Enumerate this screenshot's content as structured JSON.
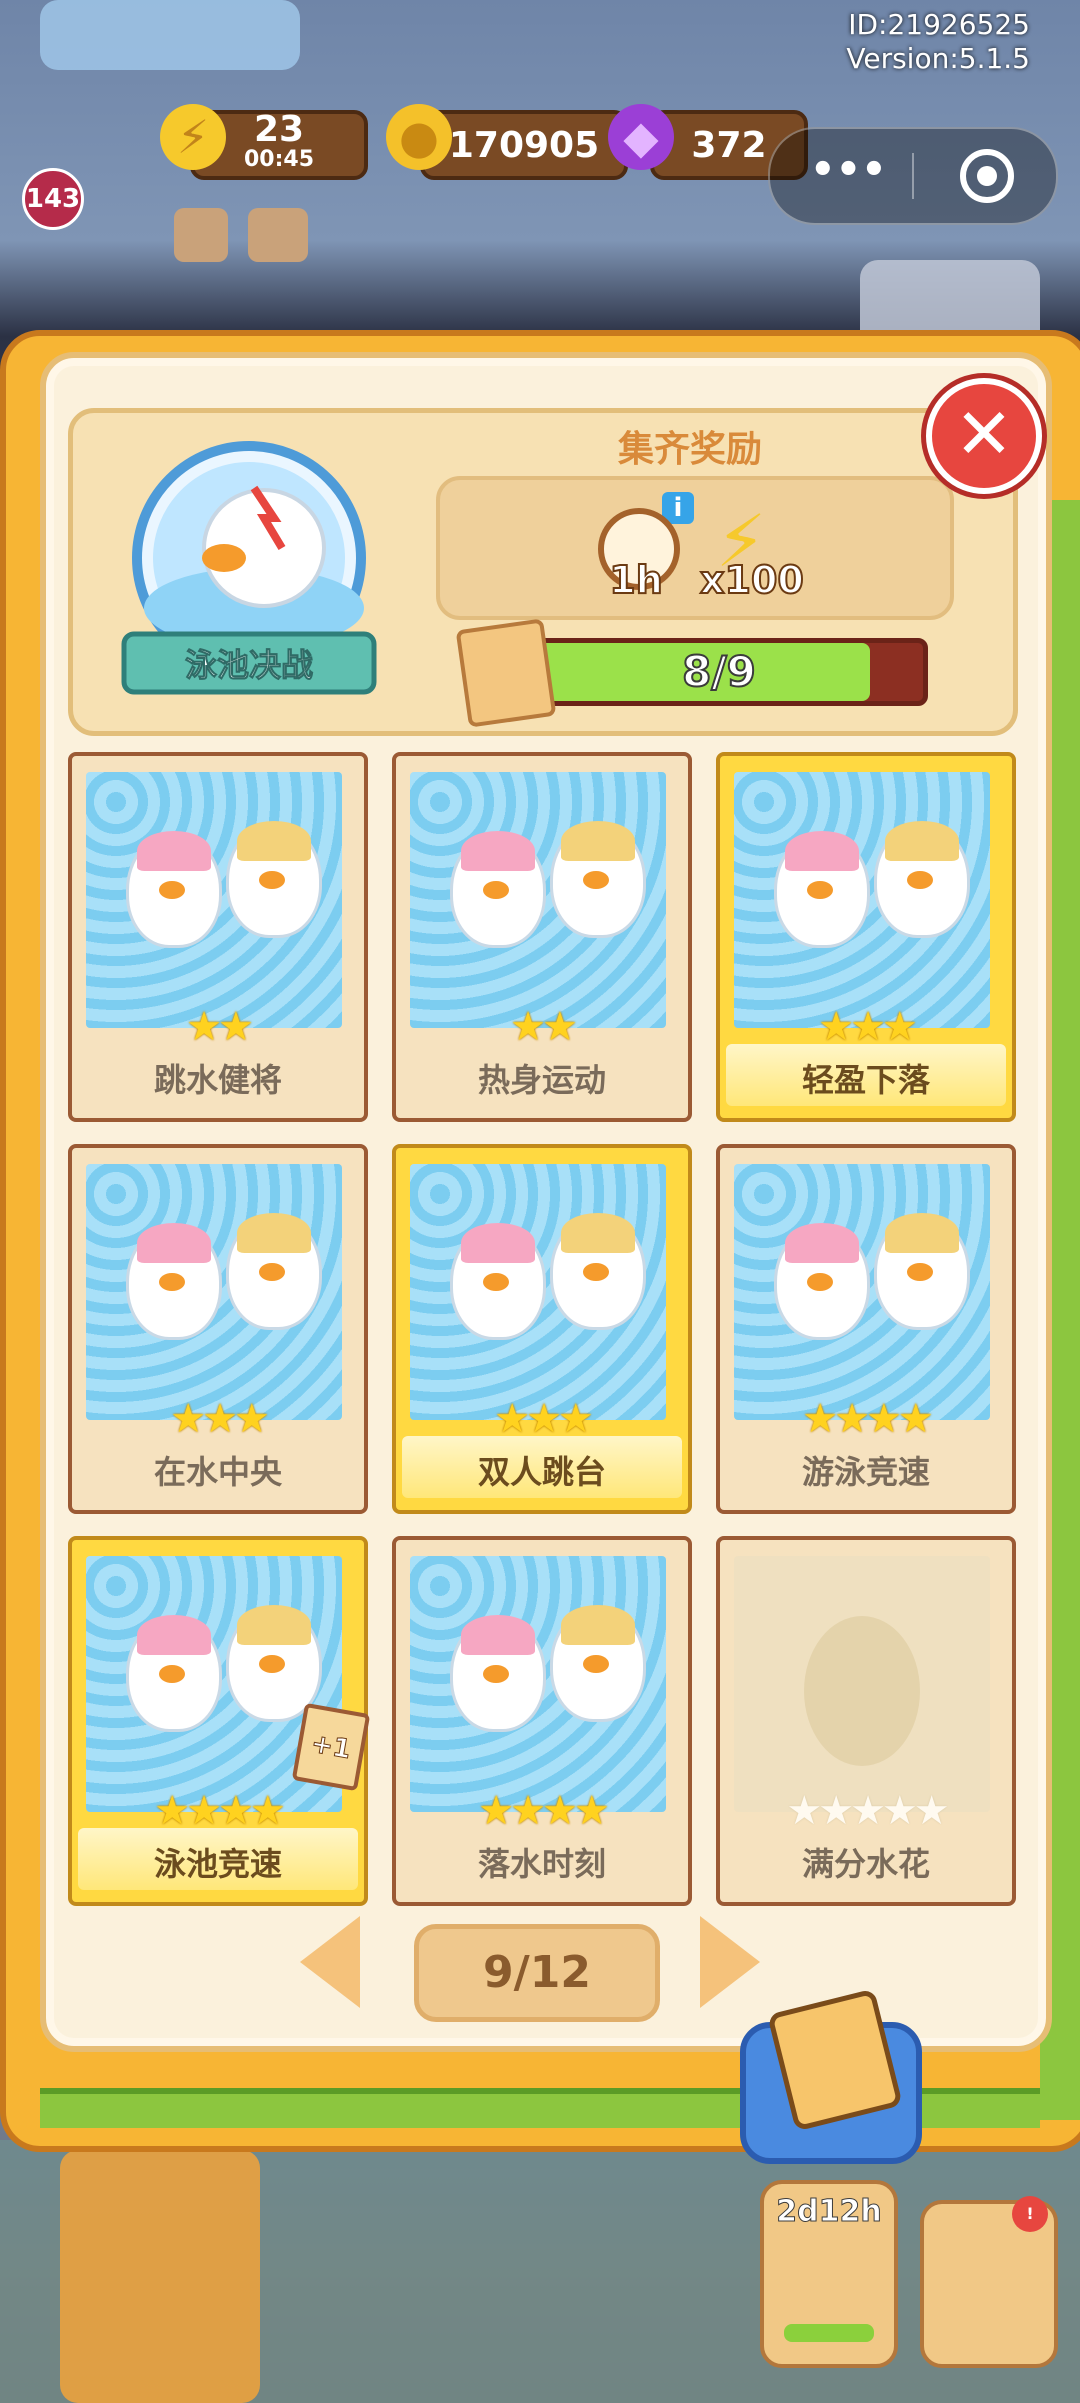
{
  "hud": {
    "energy": {
      "value": "23",
      "timer": "00:45"
    },
    "coins": "170905",
    "gems": "372",
    "id_text": "ID:21926525",
    "version_text": "Version:5.1.5",
    "level": "143"
  },
  "miniprogram": {
    "more_icon": "more-dots-icon",
    "close_icon": "target-icon"
  },
  "album": {
    "title": "泳池决战",
    "reward_title": "集齐奖励",
    "reward_time": "1h",
    "reward_energy": "x100",
    "progress_text": "8/9",
    "progress_fraction": 0.889,
    "close_icon": "close-x-icon"
  },
  "cards": [
    {
      "name": "跳水健将",
      "stars": 2,
      "max": 2,
      "gold": false
    },
    {
      "name": "热身运动",
      "stars": 2,
      "max": 2,
      "gold": false
    },
    {
      "name": "轻盈下落",
      "stars": 3,
      "max": 3,
      "gold": true
    },
    {
      "name": "在水中央",
      "stars": 3,
      "max": 3,
      "gold": false
    },
    {
      "name": "双人跳台",
      "stars": 3,
      "max": 3,
      "gold": true
    },
    {
      "name": "游泳竞速",
      "stars": 4,
      "max": 4,
      "gold": false
    },
    {
      "name": "泳池竞速",
      "stars": 4,
      "max": 4,
      "gold": true,
      "badge": "+1"
    },
    {
      "name": "落水时刻",
      "stars": 4,
      "max": 4,
      "gold": false
    },
    {
      "name": "满分水花",
      "stars": 0,
      "max": 5,
      "gold": false,
      "locked": true
    }
  ],
  "pager": {
    "label": "9/12",
    "prev_icon": "arrow-left-icon",
    "next_icon": "arrow-right-icon"
  },
  "footer": {
    "event_timer": "2d12h"
  },
  "colors": {
    "gold_card": "#ffd941",
    "progress": "#9be14a",
    "close": "#e7463f",
    "book": "#f7b534"
  }
}
